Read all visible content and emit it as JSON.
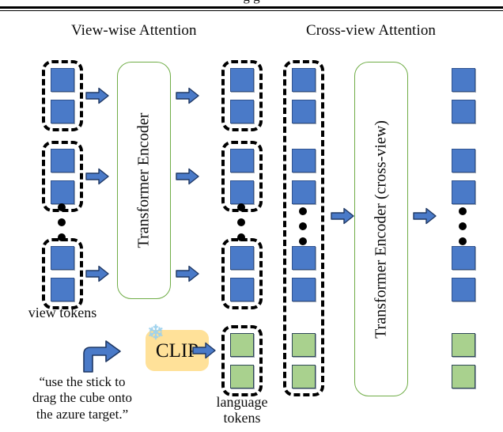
{
  "figure": {
    "top_cropped_text": "g g",
    "sections": [
      {
        "label": "View-wise Attention"
      },
      {
        "label": "Cross-view Attention"
      }
    ],
    "captions": {
      "view_tokens": "view tokens",
      "language_tokens_line1": "language",
      "language_tokens_line2": "tokens"
    },
    "prompt": {
      "line1": "“use the stick to",
      "line2": "drag the cube onto",
      "line3": "the azure target.”"
    },
    "clip": {
      "label": "CLIP",
      "frozen_icon": "❄"
    },
    "encoders": [
      {
        "label": "Transformer Encoder"
      },
      {
        "label": "Transformer Encoder (cross-view)"
      }
    ],
    "colors": {
      "view_token": "#4A7AC8",
      "language_token": "#A9D18E",
      "encoder_border": "#70AD47",
      "clip_fill": "#FFE199",
      "group_outline": "#000000",
      "arrow_fill": "#4A7AC8",
      "snowflake": "#9FD3EF"
    },
    "columns": {
      "input_view_tokens": {
        "groups": [
          {
            "tokens": [
              "view_token",
              "view_token"
            ]
          },
          {
            "tokens": [
              "view_token",
              "view_token"
            ]
          },
          {
            "tokens": [
              "view_token",
              "view_token"
            ]
          }
        ],
        "ellipsis": "⋮"
      },
      "encoded_view_tokens": {
        "groups": [
          {
            "tokens": [
              "view_token",
              "view_token"
            ]
          },
          {
            "tokens": [
              "view_token",
              "view_token"
            ]
          },
          {
            "tokens": [
              "view_token",
              "view_token"
            ]
          }
        ],
        "language_group": {
          "tokens": [
            "language_token",
            "language_token"
          ]
        },
        "ellipsis": "⋮"
      },
      "concatenated_tokens": {
        "tokens": [
          "view_token",
          "view_token",
          "view_token",
          "view_token",
          "view_token",
          "view_token",
          "language_token",
          "language_token"
        ],
        "ellipsis": "⋮"
      },
      "output_tokens": {
        "tokens": [
          "view_token",
          "view_token",
          "view_token",
          "view_token",
          "view_token",
          "view_token",
          "language_token",
          "language_token"
        ],
        "ellipsis": "⋮"
      }
    }
  }
}
